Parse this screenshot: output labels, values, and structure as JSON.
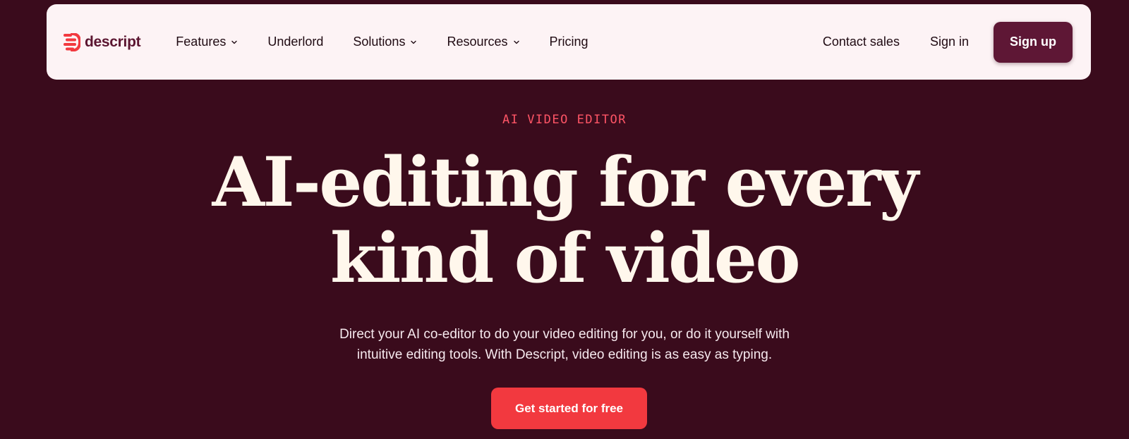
{
  "brand": {
    "name": "descript",
    "logo_icon": "descript-logo-icon",
    "colors": {
      "primary": "#5e1735",
      "accent": "#f2393f",
      "background": "#3a0b1c",
      "nav_background": "#fdf3f5"
    }
  },
  "nav": {
    "items": [
      {
        "label": "Features",
        "has_dropdown": true
      },
      {
        "label": "Underlord",
        "has_dropdown": false
      },
      {
        "label": "Solutions",
        "has_dropdown": true
      },
      {
        "label": "Resources",
        "has_dropdown": true
      },
      {
        "label": "Pricing",
        "has_dropdown": false
      }
    ],
    "contact_label": "Contact sales",
    "signin_label": "Sign in",
    "signup_label": "Sign up"
  },
  "hero": {
    "eyebrow": "AI VIDEO EDITOR",
    "headline_line1": "AI-editing for every",
    "headline_line2": "kind of video",
    "subhead_line1": "Direct your AI co-editor to do your video editing for you, or do it yourself with",
    "subhead_line2": "intuitive editing tools. With Descript, video editing is as easy as typing.",
    "cta_label": "Get started for free"
  }
}
